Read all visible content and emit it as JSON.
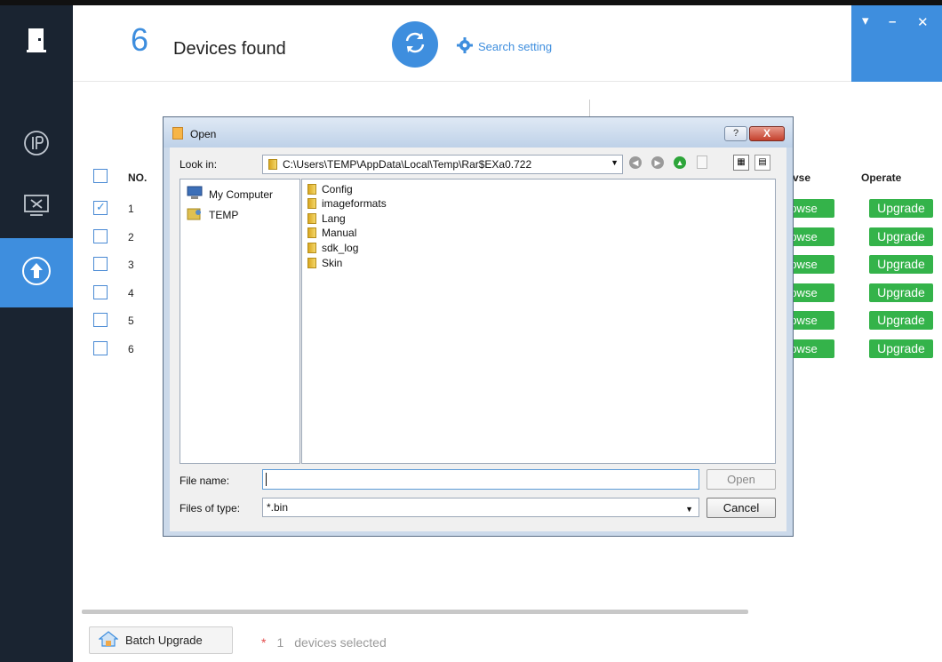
{
  "header": {
    "device_count": "6",
    "devices_found_label": "Devices found",
    "search_setting_label": "Search setting"
  },
  "window_controls": {
    "menu_glyph": "▾",
    "minimize_glyph": "–",
    "close_glyph": "✕"
  },
  "sidebar": {
    "items": [
      {
        "icon": "door-exit-icon"
      },
      {
        "icon": "ip-icon"
      },
      {
        "icon": "tools-monitor-icon"
      },
      {
        "icon": "upgrade-icon",
        "active": true
      }
    ]
  },
  "table": {
    "headers": {
      "no": "NO.",
      "browse": "vse",
      "operate": "Operate"
    },
    "rows": [
      {
        "no": "1",
        "checked": true,
        "browse": "rowse",
        "operate": "Upgrade"
      },
      {
        "no": "2",
        "checked": false,
        "browse": "rowse",
        "operate": "Upgrade"
      },
      {
        "no": "3",
        "checked": false,
        "browse": "rowse",
        "operate": "Upgrade"
      },
      {
        "no": "4",
        "checked": false,
        "browse": "rowse",
        "operate": "Upgrade"
      },
      {
        "no": "5",
        "checked": false,
        "browse": "rowse",
        "operate": "Upgrade"
      },
      {
        "no": "6",
        "checked": false,
        "browse": "rowse",
        "operate": "Upgrade"
      }
    ]
  },
  "footer": {
    "batch_upgrade_label": "Batch Upgrade",
    "star": "*",
    "selected_count": "1",
    "selected_label": "devices selected"
  },
  "dialog": {
    "title": "Open",
    "help_glyph": "?",
    "close_glyph": "X",
    "look_in_label": "Look in:",
    "look_in_path": "C:\\Users\\TEMP\\AppData\\Local\\Temp\\Rar$EXa0.722",
    "places": [
      "My Computer",
      "TEMP"
    ],
    "files": [
      "Config",
      "imageformats",
      "Lang",
      "Manual",
      "sdk_log",
      "Skin"
    ],
    "file_name_label": "File name:",
    "file_name_value": "",
    "open_button": "Open",
    "files_of_type_label": "Files of type:",
    "files_of_type_value": "*.bin",
    "cancel_button": "Cancel"
  },
  "colors": {
    "accent": "#3e8ede",
    "sidebar_bg": "#1a2431",
    "green_button": "#34b34a",
    "star_red": "#e34d4d"
  }
}
